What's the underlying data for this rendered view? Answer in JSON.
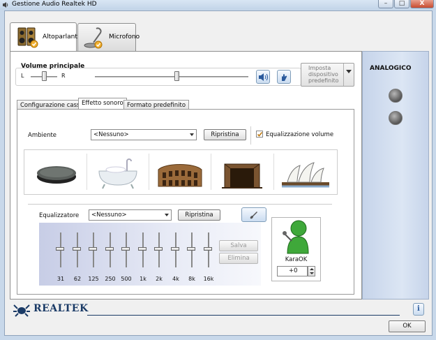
{
  "window": {
    "title": "Gestione Audio Realtek HD",
    "min": "–",
    "max": "□",
    "close": "X"
  },
  "device_tabs": [
    {
      "label": "Altoparlanti",
      "active": true
    },
    {
      "label": "Microfono",
      "active": false
    }
  ],
  "volume": {
    "label": "Volume principale",
    "left": "L",
    "right": "R",
    "balance": 0.5,
    "level": 0.53
  },
  "default_device": {
    "line1": "Imposta",
    "line2": "dispositivo",
    "line3": "predefinito"
  },
  "sub_tabs": [
    {
      "label": "Configurazione casse",
      "active": false
    },
    {
      "label": "Effetto sonoro",
      "active": true
    },
    {
      "label": "Formato predefinito",
      "active": false
    }
  ],
  "environment": {
    "label": "Ambiente",
    "value": "<Nessuno>",
    "reset_label": "Ripristina",
    "eq_volume_label": "Equalizzazione volume",
    "eq_volume_checked": true,
    "presets": [
      "disc",
      "bathtub",
      "colosseum",
      "stone-room",
      "opera-house"
    ]
  },
  "equalizer": {
    "label": "Equalizzatore",
    "value": "<Nessuno>",
    "reset_label": "Ripristina",
    "save_label": "Salva",
    "delete_label": "Elimina",
    "bands": [
      "31",
      "62",
      "125",
      "250",
      "500",
      "1k",
      "2k",
      "4k",
      "8k",
      "16k"
    ]
  },
  "karaok": {
    "label": "KaraOK",
    "value": "+0"
  },
  "side_panel": {
    "title": "ANALOGICO"
  },
  "brand": {
    "name": "REALTEK",
    "info_icon": "i"
  },
  "ok_label": "OK",
  "colors": {
    "accent": "#1a3a66",
    "karaok_green": "#3fa83a"
  }
}
